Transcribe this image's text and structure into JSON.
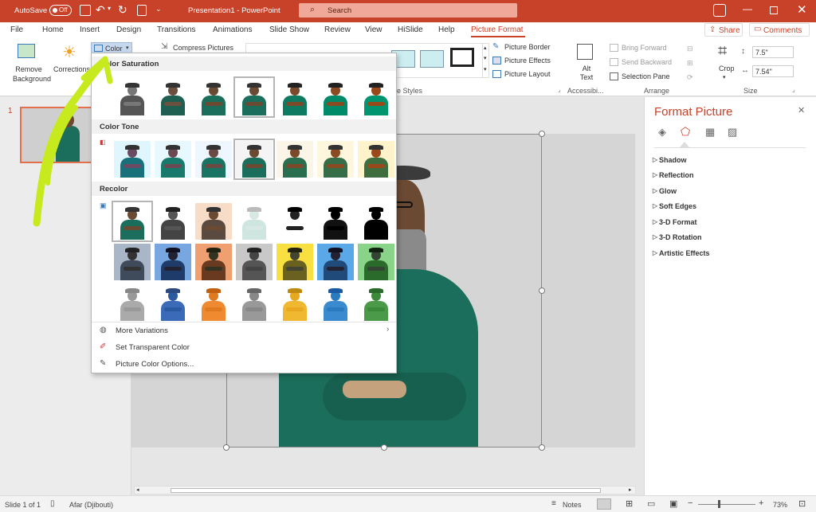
{
  "titlebar": {
    "autosave": "AutoSave",
    "toggle": "Off",
    "doc_title": "Presentation1  -  PowerPoint",
    "search": "Search"
  },
  "tabs": [
    "File",
    "Home",
    "Insert",
    "Design",
    "Transitions",
    "Animations",
    "Slide Show",
    "Review",
    "View",
    "HiSlide",
    "Help",
    "Picture Format"
  ],
  "share": "Share",
  "comments": "Comments",
  "ribbon": {
    "remove_bg": "Remove Background",
    "corrections": "Corrections",
    "color": "Color",
    "compress": "Compress Pictures",
    "picture_border": "Picture Border",
    "picture_effects": "Picture Effects",
    "picture_layout": "Picture Layout",
    "styles_label": "e Styles",
    "alt_text": "Alt Text",
    "accessibility": "Accessibi...",
    "bring_forward": "Bring Forward",
    "send_backward": "Send Backward",
    "selection_pane": "Selection Pane",
    "arrange": "Arrange",
    "crop": "Crop",
    "height": "7.5\"",
    "width": "7.54\"",
    "size": "Size"
  },
  "dropdown": {
    "sat_header": "Color Saturation",
    "tone_header": "Color Tone",
    "recolor_header": "Recolor",
    "more_variations": "More Variations",
    "set_transparent": "Set Transparent Color",
    "color_options": "Picture Color Options..."
  },
  "slide_number": "1",
  "panel": {
    "title": "Format Picture",
    "items": [
      "Shadow",
      "Reflection",
      "Glow",
      "Soft Edges",
      "3-D Format",
      "3-D Rotation",
      "Artistic Effects"
    ]
  },
  "status": {
    "slide": "Slide 1 of 1",
    "language": "Afar (Djibouti)",
    "notes": "Notes",
    "zoom": "73%"
  },
  "colors": {
    "accent": "#c8422a",
    "highlighter": "#c6ea1e",
    "sweater": "#1c6e5c"
  }
}
